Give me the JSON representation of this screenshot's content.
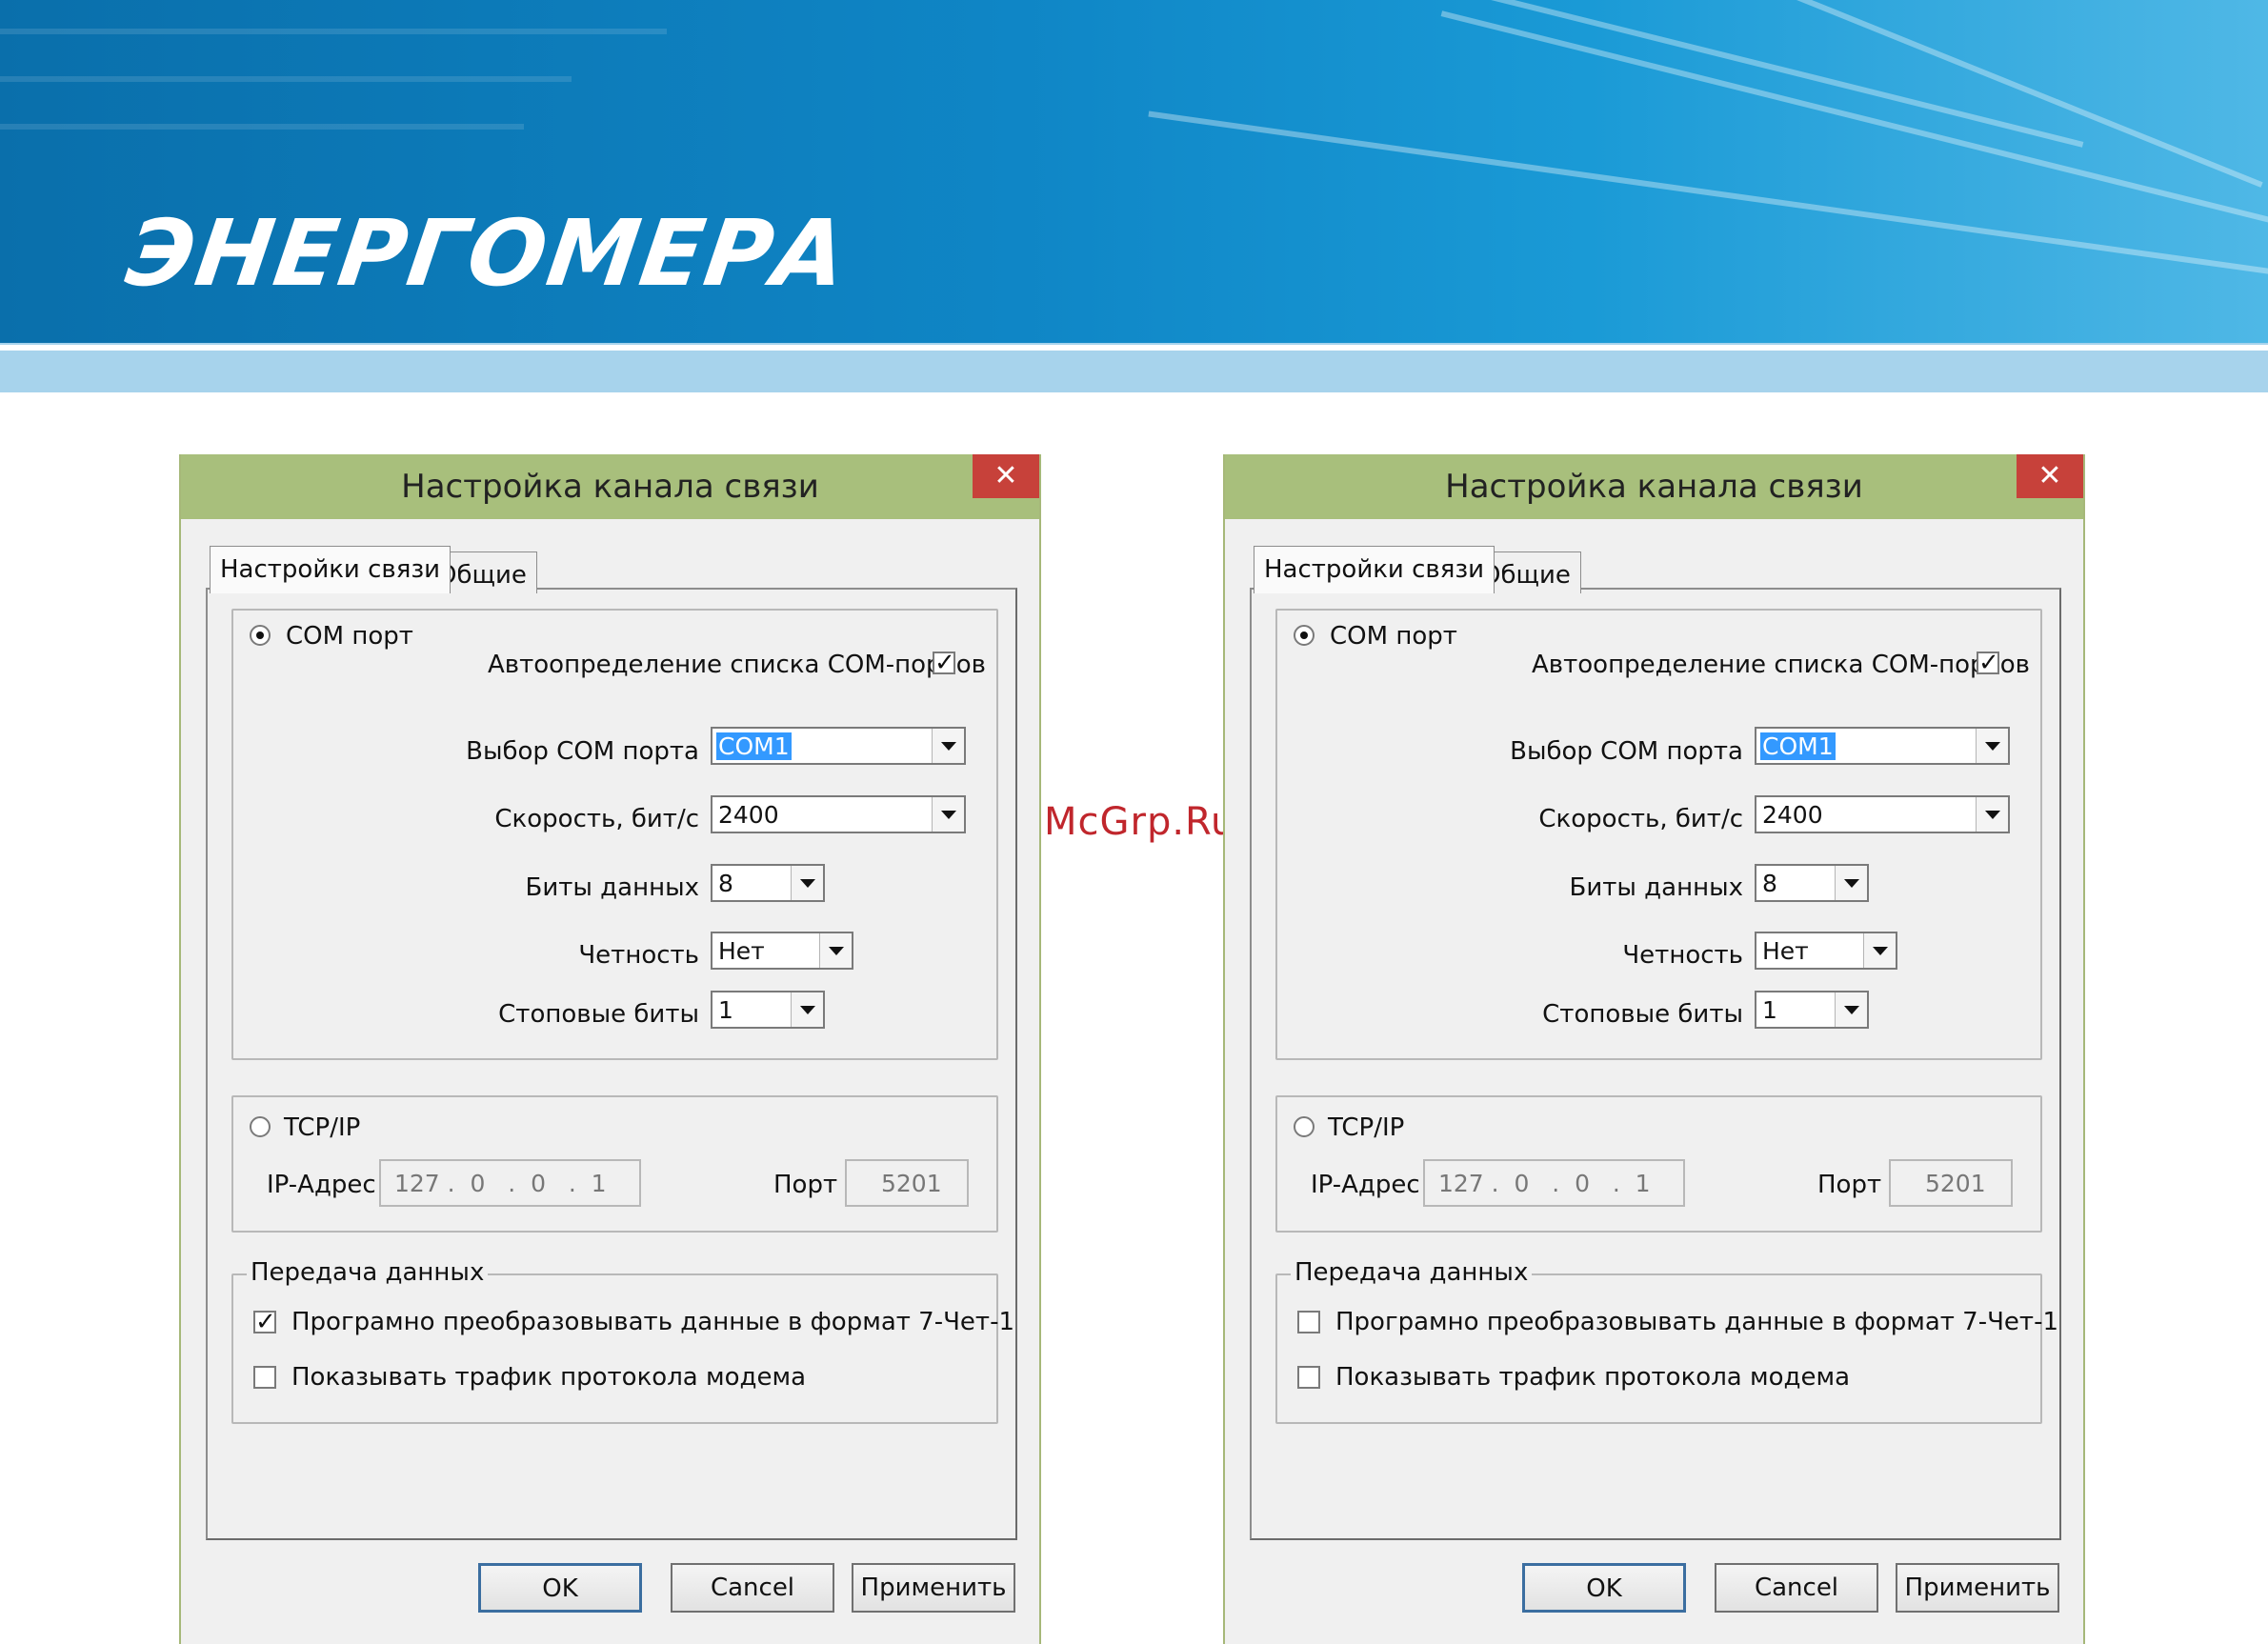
{
  "brand": {
    "logo_text": "ЭНЕРГОМЕРА"
  },
  "watermark": "McGrp.Ru",
  "dialogs": [
    {
      "title": "Настройка канала связи",
      "close_glyph": "✕",
      "tabs": [
        "Настройки связи",
        "Общие"
      ],
      "com": {
        "radio_label": "COM порт",
        "selected": true,
        "autodetect_label": "Автоопределение списка COM-портов",
        "autodetect_checked": true,
        "port_label": "Выбор COM порта",
        "port_value": "COM1",
        "speed_label": "Скорость, бит/с",
        "speed_value": "2400",
        "databits_label": "Биты данных",
        "databits_value": "8",
        "parity_label": "Четность",
        "parity_value": "Нет",
        "stopbits_label": "Стоповые биты",
        "stopbits_value": "1"
      },
      "tcp": {
        "radio_label": "TCP/IP",
        "selected": false,
        "ip_label": "IP-Адрес",
        "ip_value": "127 .  0   .  0   .  1",
        "port_label": "Порт",
        "port_value": "5201"
      },
      "transfer": {
        "legend": "Передача данных",
        "convert_label": "Програмно преобразовывать данные в формат 7-Чет-1",
        "convert_checked": true,
        "traffic_label": "Показывать трафик протокола модема",
        "traffic_checked": false
      },
      "buttons": {
        "ok": "OK",
        "cancel": "Cancel",
        "apply": "Применить"
      }
    },
    {
      "title": "Настройка канала связи",
      "close_glyph": "✕",
      "tabs": [
        "Настройки связи",
        "Общие"
      ],
      "com": {
        "radio_label": "COM порт",
        "selected": true,
        "autodetect_label": "Автоопределение списка COM-портов",
        "autodetect_checked": true,
        "port_label": "Выбор COM порта",
        "port_value": "COM1",
        "speed_label": "Скорость, бит/с",
        "speed_value": "2400",
        "databits_label": "Биты данных",
        "databits_value": "8",
        "parity_label": "Четность",
        "parity_value": "Нет",
        "stopbits_label": "Стоповые биты",
        "stopbits_value": "1"
      },
      "tcp": {
        "radio_label": "TCP/IP",
        "selected": false,
        "ip_label": "IP-Адрес",
        "ip_value": "127 .  0   .  0   .  1",
        "port_label": "Порт",
        "port_value": "5201"
      },
      "transfer": {
        "legend": "Передача данных",
        "convert_label": "Програмно преобразовывать данные в формат 7-Чет-1",
        "convert_checked": false,
        "traffic_label": "Показывать трафик протокола модема",
        "traffic_checked": false
      },
      "buttons": {
        "ok": "OK",
        "cancel": "Cancel",
        "apply": "Применить"
      }
    }
  ],
  "colors": {
    "titlebar": "#a8bf7c",
    "close": "#c7413a",
    "banner": "#0f86c6",
    "watermark": "#c0262c",
    "selection": "#3399ff"
  }
}
